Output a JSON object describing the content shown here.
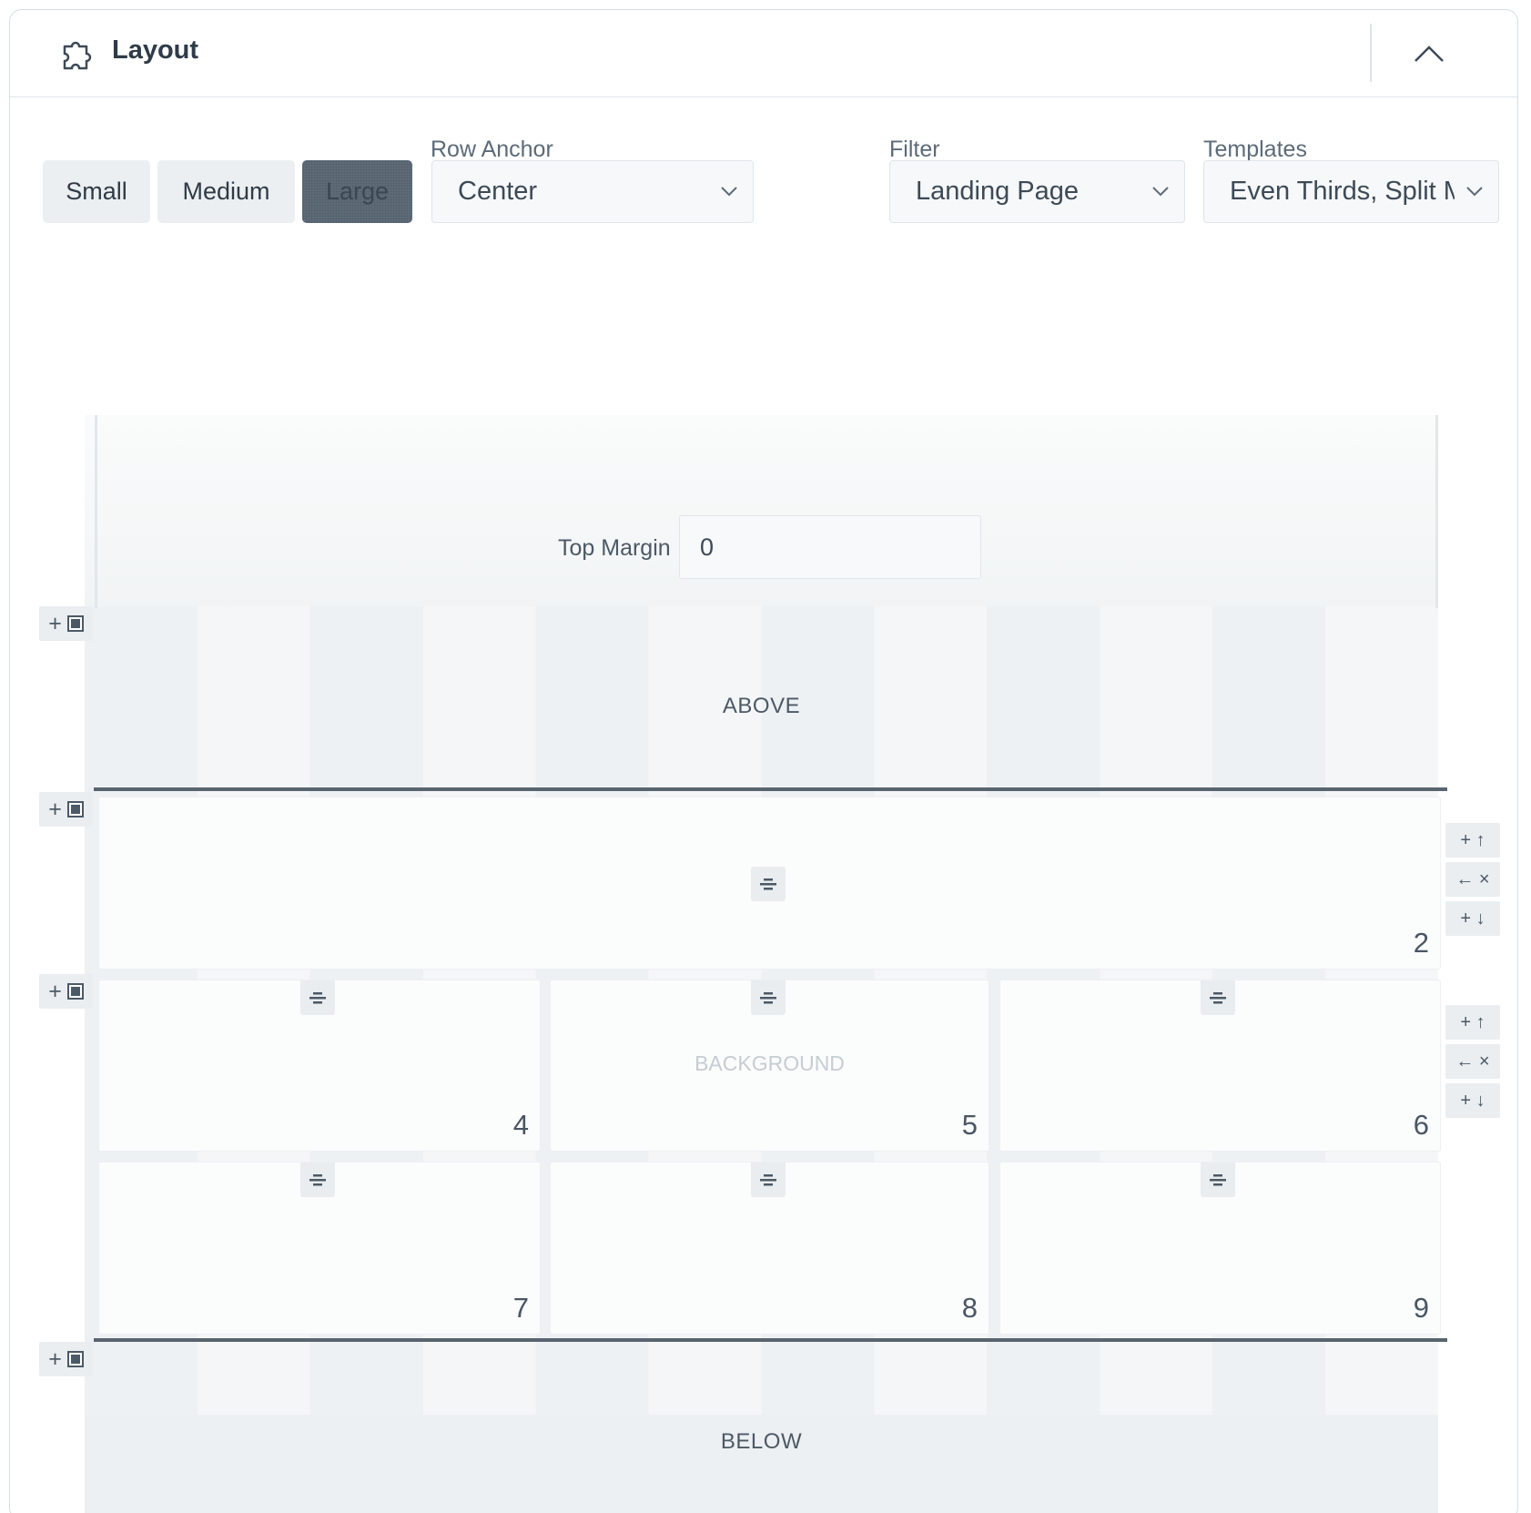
{
  "panel": {
    "title": "Layout",
    "icons": {
      "title": "puzzle-icon",
      "collapse": "chevron-up-icon"
    }
  },
  "size_buttons": [
    {
      "label": "Small",
      "active": false
    },
    {
      "label": "Medium",
      "active": false
    },
    {
      "label": "Large",
      "active": true
    }
  ],
  "row_anchor": {
    "label": "Row Anchor",
    "value": "Center"
  },
  "filter": {
    "label": "Filter",
    "value": "Landing Page"
  },
  "templates": {
    "label": "Templates",
    "value": "Even Thirds, Split M"
  },
  "top_margin": {
    "label": "Top Margin",
    "value": "0"
  },
  "bands": {
    "above": "ABOVE",
    "below": "BELOW",
    "background": "BACKGROUND"
  },
  "cells": {
    "row1": [
      "2"
    ],
    "row2": [
      "4",
      "5",
      "6"
    ],
    "row3": [
      "7",
      "8",
      "9"
    ]
  },
  "row_controls": {
    "add_above": "+",
    "move_up": "+ ↑",
    "delete": "← ×",
    "move_down": "+ ↓"
  },
  "colors": {
    "accent": "#5e6c79",
    "row_border": "#58646f",
    "background": "#ffffff"
  }
}
